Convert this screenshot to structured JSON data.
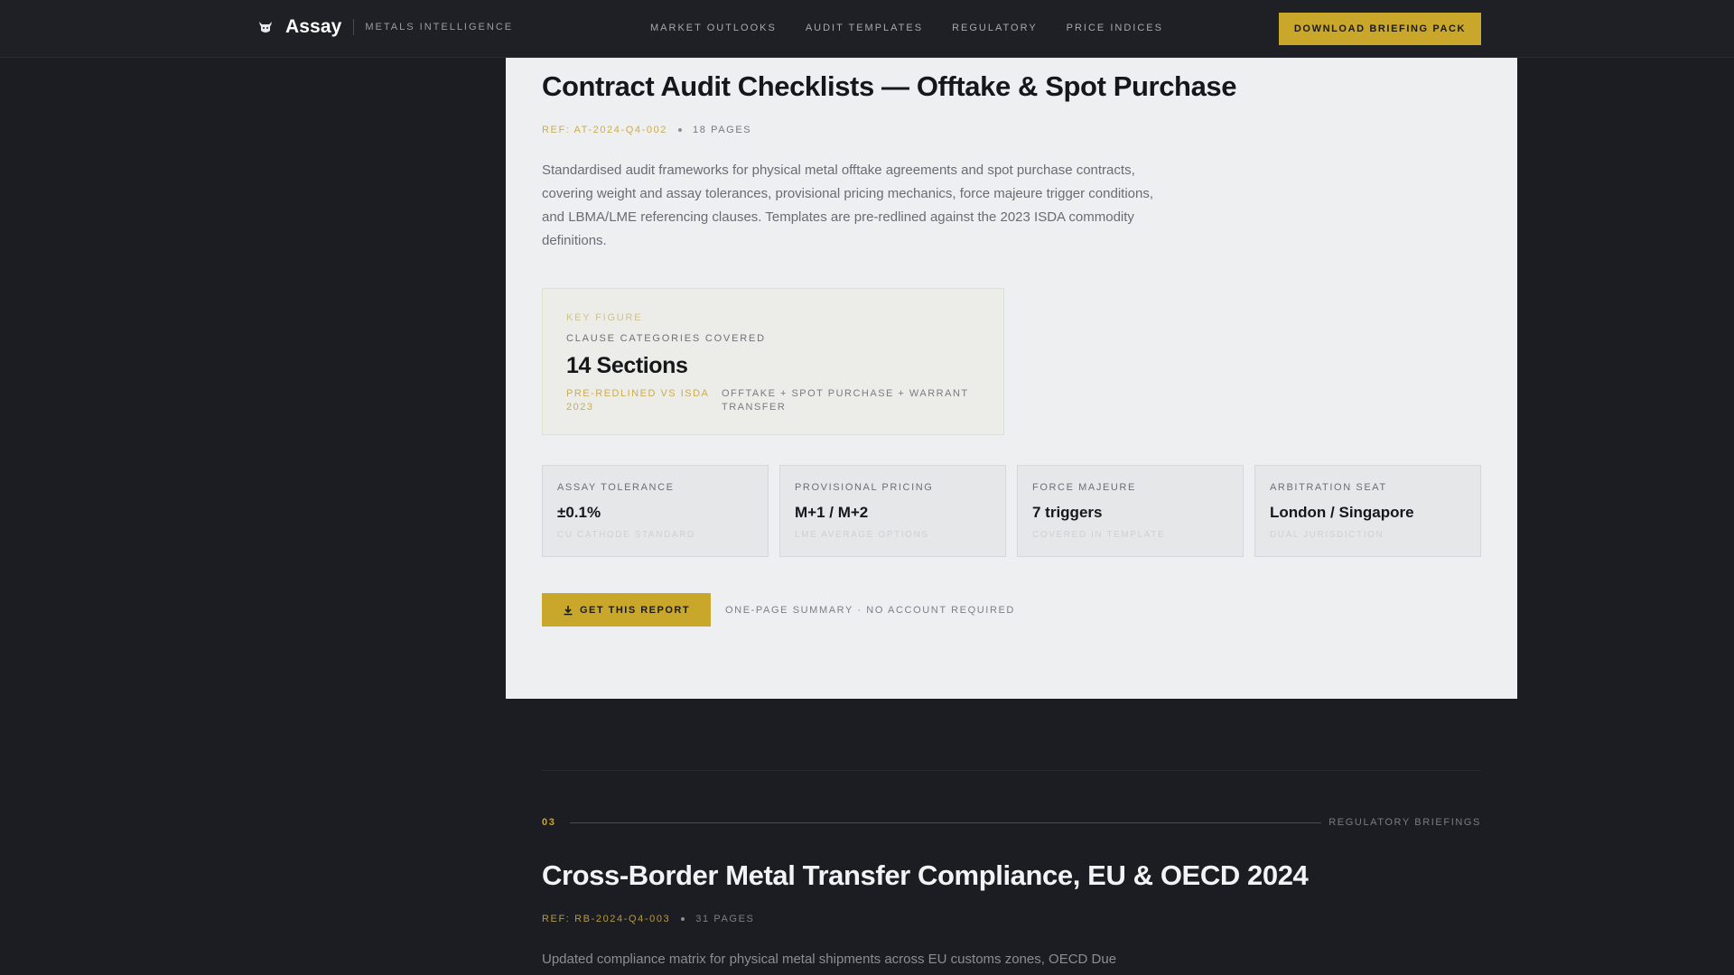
{
  "header": {
    "brand_name": "Assay",
    "brand_tagline": "METALS INTELLIGENCE",
    "nav": [
      "MARKET OUTLOOKS",
      "AUDIT TEMPLATES",
      "REGULATORY",
      "PRICE INDICES"
    ],
    "cta_label": "DOWNLOAD BRIEFING PACK"
  },
  "report": {
    "title": "Contract Audit Checklists — Offtake & Spot Purchase",
    "ref": "REF: AT-2024-Q4-002",
    "pages": "18 PAGES",
    "description": "Standardised audit frameworks for physical metal offtake agreements and spot purchase contracts, covering weight and assay tolerances, provisional pricing mechanics, force majeure trigger conditions, and LBMA/LME referencing clauses. Templates are pre-redlined against the 2023 ISDA commodity definitions.",
    "key_figure": {
      "label": "KEY FIGURE",
      "subtitle": "CLAUSE CATEGORIES COVERED",
      "value": "14 Sections",
      "note_left": "PRE-REDLINED VS ISDA 2023",
      "note_right": "OFFTAKE + SPOT PURCHASE + WARRANT TRANSFER"
    },
    "stats": [
      {
        "label": "ASSAY TOLERANCE",
        "value": "±0.1%",
        "note": "CU CATHODE STANDARD"
      },
      {
        "label": "PROVISIONAL PRICING",
        "value": "M+1 / M+2",
        "note": "LME AVERAGE OPTIONS"
      },
      {
        "label": "FORCE MAJEURE",
        "value": "7 triggers",
        "note": "COVERED IN TEMPLATE"
      },
      {
        "label": "ARBITRATION SEAT",
        "value": "London / Singapore",
        "note": "DUAL JURISDICTION"
      }
    ],
    "cta_label": "GET THIS REPORT",
    "cta_note": "ONE-PAGE SUMMARY · NO ACCOUNT REQUIRED"
  },
  "next_section": {
    "number": "03",
    "category": "REGULATORY BRIEFINGS",
    "title": "Cross-Border Metal Transfer Compliance, EU & OECD 2024",
    "ref": "REF: RB-2024-Q4-003",
    "pages": "31 PAGES",
    "description": "Updated compliance matrix for physical metal shipments across EU customs zones, OECD Due"
  },
  "colors": {
    "accent": "#c9a72a",
    "dark_bg": "#1c1d22",
    "card_bg": "#eeeff1"
  }
}
